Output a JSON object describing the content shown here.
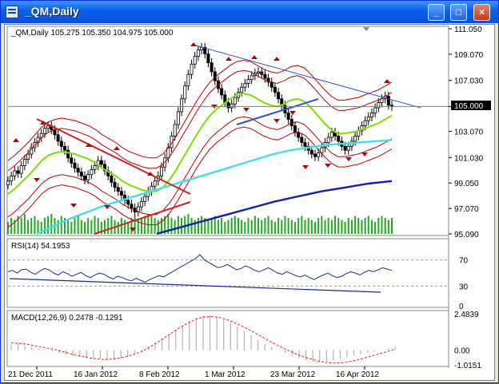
{
  "window": {
    "title": "_QM,Daily",
    "minimize_glyph": "_",
    "maximize_glyph": "□",
    "close_glyph": "×"
  },
  "icons": {
    "app": "chart-window-icon",
    "minimize": "minimize-icon",
    "maximize": "maximize-icon",
    "close": "close-icon"
  },
  "colors": {
    "up": "#000000",
    "down": "#000000",
    "ma_fast": "#7fe000",
    "ma_mid": "#40e0e8",
    "ma_slow": "#1020b0",
    "band": "#c00000",
    "trend_red": "#d02020",
    "trend_blue": "#3050e0",
    "macd_signal": "#e02020"
  },
  "chart_data": [
    {
      "type": "candlestick",
      "header": "_QM,Daily  105.275 105.350 104.975 105.000",
      "price_ticks": [
        "111.050",
        "109.070",
        "107.030",
        "105.000",
        "103.070",
        "101.030",
        "99.050",
        "97.070",
        "95.090"
      ],
      "current_price": "105.000",
      "ylim": [
        95.09,
        111.05
      ],
      "dates": [
        "21 Dec 2011",
        "16 Jan 2012",
        "8 Feb 2012",
        "1 Mar 2012",
        "23 Mar 2012",
        "16 Apr 2012"
      ],
      "close": [
        99.2,
        99.6,
        100.0,
        99.8,
        100.4,
        100.9,
        101.3,
        101.8,
        102.2,
        102.6,
        102.9,
        103.3,
        103.5,
        103.2,
        102.8,
        102.3,
        101.9,
        101.6,
        101.0,
        100.6,
        100.2,
        99.9,
        99.6,
        99.3,
        99.7,
        100.1,
        100.4,
        100.8,
        100.5,
        100.0,
        99.6,
        99.1,
        98.7,
        98.4,
        98.1,
        97.7,
        97.4,
        97.1,
        96.8,
        97.2,
        97.6,
        98.0,
        98.4,
        98.8,
        99.2,
        99.6,
        100.3,
        101.0,
        101.8,
        102.7,
        103.6,
        104.6,
        105.6,
        106.6,
        107.5,
        108.3,
        108.9,
        109.4,
        109.6,
        109.1,
        108.4,
        107.7,
        107.0,
        106.4,
        105.9,
        105.3,
        104.9,
        105.2,
        105.7,
        106.1,
        106.5,
        106.8,
        107.1,
        107.4,
        107.6,
        107.7,
        107.5,
        107.2,
        106.9,
        106.5,
        106.1,
        105.6,
        105.1,
        104.5,
        104.0,
        103.5,
        103.0,
        102.6,
        102.2,
        101.9,
        101.6,
        101.3,
        101.1,
        101.4,
        101.8,
        102.2,
        102.6,
        103.0,
        102.7,
        102.3,
        101.9,
        101.6,
        101.9,
        102.3,
        102.7,
        103.1,
        103.5,
        103.9,
        104.2,
        104.5,
        104.9,
        105.3,
        105.6,
        105.8,
        105.1,
        105.0
      ],
      "ma_fast": [
        98.2,
        98.6,
        99.1,
        99.6,
        100.2,
        100.8,
        101.2,
        101.4,
        101.5,
        101.4,
        101.3,
        101.1,
        100.9,
        100.6,
        100.2,
        99.9,
        99.6,
        99.2,
        98.9,
        98.7,
        98.5,
        98.4,
        98.4,
        98.7,
        99.3,
        100.1,
        101.0,
        101.9,
        102.8,
        103.6,
        104.3,
        104.8,
        105.2,
        105.6,
        105.9,
        106.0,
        105.9,
        105.6,
        105.3,
        105.1,
        105.0,
        105.2,
        105.5,
        105.6,
        105.4,
        104.9,
        104.3,
        103.7,
        103.2,
        102.9,
        102.9,
        103.0,
        103.1,
        103.3,
        103.5,
        103.7,
        104.0,
        104.3
      ],
      "ma_mid": [
        95.1,
        95.7,
        96.3,
        96.8,
        97.3,
        97.7,
        98.1,
        98.5,
        98.9,
        99.3,
        99.7,
        100.1,
        100.5,
        100.9,
        101.3,
        101.6,
        101.8,
        102.0,
        102.1,
        102.2,
        102.3,
        102.4
      ],
      "ma_slow": [
        95.1,
        95.6,
        96.1,
        96.6,
        97.1,
        97.6,
        98.0,
        98.4,
        98.7,
        99.0,
        99.2
      ],
      "volume": [
        6,
        8,
        7,
        9,
        8,
        10,
        7,
        8,
        9,
        7,
        6,
        8,
        9,
        10,
        8,
        7,
        9,
        8,
        7,
        6,
        8,
        9,
        7,
        6,
        8,
        7,
        9,
        8,
        6,
        7,
        8,
        9,
        7,
        6,
        8,
        7,
        6,
        8,
        9,
        7,
        8,
        9,
        10,
        9,
        8,
        7,
        8,
        9,
        10,
        8,
        7,
        9,
        8,
        9,
        10,
        8,
        7,
        8,
        9,
        8,
        7,
        8,
        9,
        7,
        8,
        6,
        7,
        8,
        9,
        8,
        7,
        6,
        8,
        7,
        9,
        8,
        7,
        8,
        9,
        7,
        6,
        8,
        7,
        9,
        8,
        7,
        6,
        8,
        9,
        7,
        8,
        7,
        6,
        8,
        9,
        7,
        8,
        7,
        9,
        8,
        7,
        6,
        8,
        7,
        9,
        8,
        7,
        8,
        9,
        7,
        6,
        8,
        9,
        8,
        7,
        8
      ]
    },
    {
      "type": "line",
      "header": "RSI(14) 54.1953",
      "ticks": [
        "70",
        "30",
        "0"
      ],
      "levels": [
        70,
        30
      ],
      "ylim": [
        0,
        100
      ],
      "values": [
        52,
        54,
        50,
        55,
        56,
        51,
        48,
        53,
        57,
        55,
        50,
        47,
        52,
        49,
        45,
        48,
        51,
        46,
        43,
        47,
        50,
        48,
        44,
        41,
        45,
        43,
        40,
        38,
        42,
        39,
        36,
        40,
        43,
        46,
        44,
        48,
        52,
        56,
        60,
        64,
        68,
        72,
        78,
        70,
        66,
        62,
        58,
        60,
        63,
        59,
        55,
        57,
        61,
        58,
        54,
        52,
        55,
        58,
        54,
        50,
        48,
        52,
        49,
        46,
        44,
        47,
        43,
        40,
        44,
        47,
        50,
        46,
        43,
        45,
        49,
        52,
        50,
        47,
        51,
        54,
        52,
        55,
        58,
        56,
        54
      ]
    },
    {
      "type": "bar",
      "header": "MACD(12,26,9) 0.2478 -0.1291",
      "ticks": [
        "2.4839",
        "0.00",
        "-1.0151"
      ],
      "ylim": [
        -1.0151,
        2.4839
      ],
      "histogram": [
        0.4,
        0.5,
        0.3,
        0.2,
        0.1,
        0.05,
        -0.1,
        -0.2,
        -0.3,
        -0.4,
        -0.45,
        -0.5,
        -0.55,
        -0.6,
        -0.65,
        -0.7,
        -0.6,
        -0.5,
        -0.3,
        -0.1,
        0.2,
        0.5,
        0.8,
        1.1,
        1.4,
        1.7,
        2.0,
        2.2,
        2.35,
        2.4,
        2.3,
        2.1,
        1.9,
        1.6,
        1.3,
        1.0,
        0.7,
        0.4,
        0.2,
        0.0,
        -0.2,
        -0.4,
        -0.55,
        -0.7,
        -0.8,
        -0.85,
        -0.8,
        -0.7,
        -0.6,
        -0.5,
        -0.4,
        -0.3,
        -0.2,
        -0.1,
        0.0,
        0.1,
        0.2
      ],
      "signal": [
        0.5,
        0.45,
        0.4,
        0.3,
        0.2,
        0.1,
        0.0,
        -0.15,
        -0.3,
        -0.42,
        -0.52,
        -0.6,
        -0.65,
        -0.62,
        -0.55,
        -0.45,
        -0.3,
        -0.1,
        0.2,
        0.5,
        0.85,
        1.2,
        1.55,
        1.85,
        2.1,
        2.25,
        2.3,
        2.25,
        2.1,
        1.9,
        1.65,
        1.4,
        1.1,
        0.8,
        0.5,
        0.25,
        0.0,
        -0.25,
        -0.45,
        -0.6,
        -0.75,
        -0.85,
        -0.9,
        -0.88,
        -0.8,
        -0.7,
        -0.55,
        -0.4,
        -0.25,
        -0.1,
        0.05
      ]
    }
  ]
}
